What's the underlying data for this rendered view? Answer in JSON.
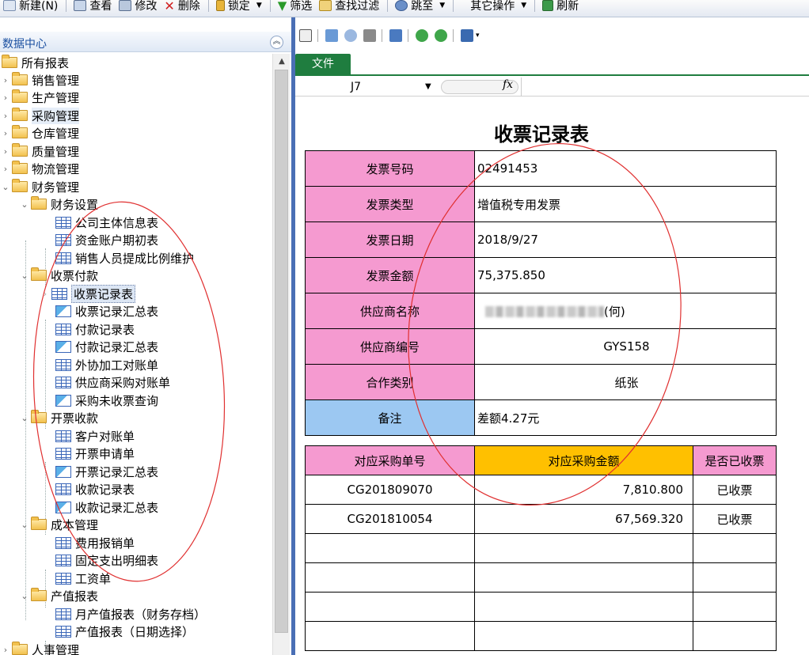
{
  "toolbar": {
    "new": "新建(N)",
    "view": "查看",
    "edit": "修改",
    "delete": "删除",
    "lock": "锁定",
    "filter": "筛选",
    "find_filter": "查找过滤",
    "jump": "跳至",
    "other_ops": "其它操作",
    "refresh": "刷新"
  },
  "nav": {
    "title": "数据中心",
    "root": "所有报表",
    "groups": {
      "sales": "销售管理",
      "production": "生产管理",
      "purchase": "采购管理",
      "warehouse": "仓库管理",
      "quality": "质量管理",
      "logistics": "物流管理",
      "finance": "财务管理",
      "hr": "人事管理"
    },
    "finance": {
      "settings": "财务设置",
      "settings_items": [
        "公司主体信息表",
        "资金账户期初表",
        "销售人员提成比例维护"
      ],
      "receipts": "收票付款",
      "receipts_items": [
        "收票记录表",
        "收票记录汇总表",
        "付款记录表",
        "付款记录汇总表",
        "外协加工对账单",
        "供应商采购对账单",
        "采购未收票查询"
      ],
      "invoicing": "开票收款",
      "invoicing_items": [
        "客户对账单",
        "开票申请单",
        "开票记录汇总表",
        "收款记录表",
        "收款记录汇总表"
      ],
      "cost": "成本管理",
      "cost_items": [
        "费用报销单",
        "固定支出明细表",
        "工资单"
      ],
      "output": "产值报表",
      "output_items": [
        "月产值报表（财务存档）",
        "产值报表（日期选择）"
      ]
    }
  },
  "spreadsheet": {
    "file_tab": "文件",
    "cell_ref": "J7",
    "fx": "fx",
    "title": "收票记录表",
    "fields": [
      {
        "label": "发票号码",
        "value": "02491453"
      },
      {
        "label": "发票类型",
        "value": "增值税专用发票"
      },
      {
        "label": "发票日期",
        "value": "2018/9/27"
      },
      {
        "label": "发票金额",
        "value": "75,375.850"
      },
      {
        "label": "供应商名称",
        "value": "(何)"
      },
      {
        "label": "供应商编号",
        "value": "GYS158"
      },
      {
        "label": "合作类别",
        "value": "纸张"
      },
      {
        "label": "备注",
        "value": "差额4.27元"
      }
    ],
    "detail_headers": [
      "对应采购单号",
      "对应采购金额",
      "是否已收票"
    ],
    "detail_rows": [
      [
        "CG201809070",
        "7,810.800",
        "已收票"
      ],
      [
        "CG201810054",
        "67,569.320",
        "已收票"
      ]
    ]
  },
  "colors": {
    "label_pink": "#f59ad0",
    "label_blue": "#9cc8f2",
    "header_gold": "#ffc000",
    "excel_green": "#1f7d3f",
    "annotation_red": "#e03030"
  }
}
